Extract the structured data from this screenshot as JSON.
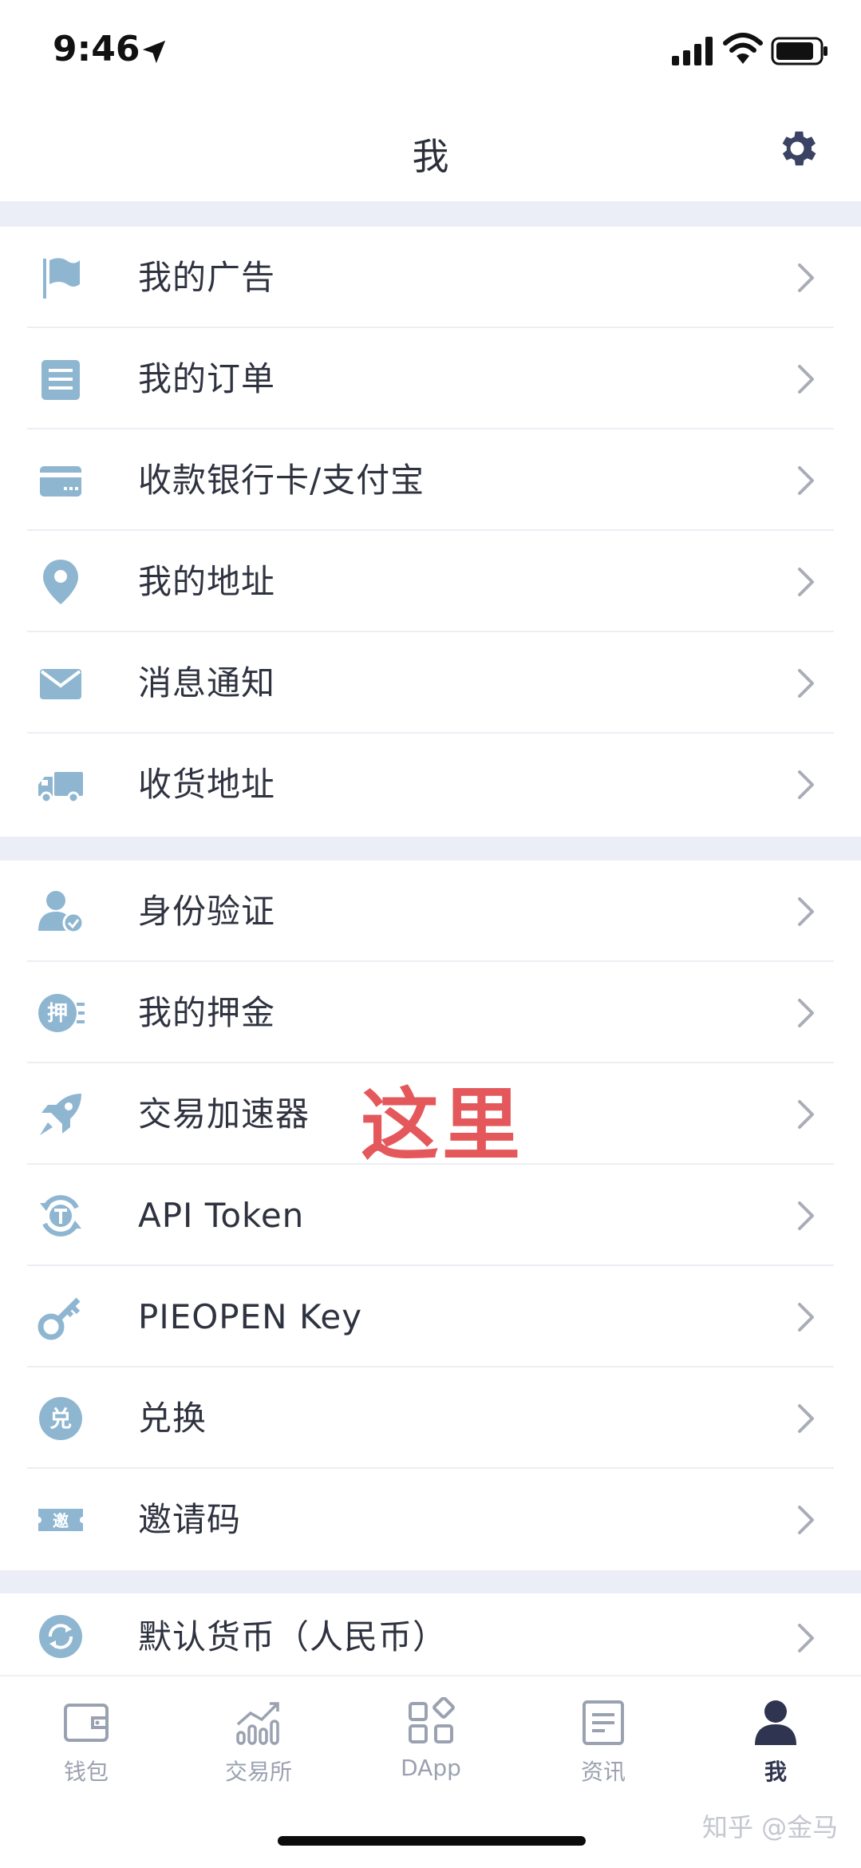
{
  "status": {
    "time": "9:46"
  },
  "header": {
    "title": "我"
  },
  "sections": [
    [
      {
        "label": "我的广告",
        "icon": "flag-icon"
      },
      {
        "label": "我的订单",
        "icon": "document-icon"
      },
      {
        "label": "收款银行卡/支付宝",
        "icon": "card-icon"
      },
      {
        "label": "我的地址",
        "icon": "location-pin-icon"
      },
      {
        "label": "消息通知",
        "icon": "envelope-icon"
      },
      {
        "label": "收货地址",
        "icon": "truck-icon"
      }
    ],
    [
      {
        "label": "身份验证",
        "icon": "user-verified-icon"
      },
      {
        "label": "我的押金",
        "icon": "deposit-icon"
      },
      {
        "label": "交易加速器",
        "icon": "rocket-icon"
      },
      {
        "label": "API Token",
        "icon": "token-icon"
      },
      {
        "label": "PIEOPEN Key",
        "icon": "key-icon"
      },
      {
        "label": "兑换",
        "icon": "exchange-icon"
      },
      {
        "label": "邀请码",
        "icon": "invite-ticket-icon"
      }
    ],
    [
      {
        "label": "默认货币（人民币）",
        "icon": "currency-refresh-icon"
      }
    ]
  ],
  "icon_text": {
    "deposit": "押",
    "exchange": "兑",
    "invite": "邀"
  },
  "annotation": "这里",
  "tabs": [
    {
      "label": "钱包",
      "icon": "wallet-icon"
    },
    {
      "label": "交易所",
      "icon": "chart-icon"
    },
    {
      "label": "DApp",
      "icon": "apps-grid-icon"
    },
    {
      "label": "资讯",
      "icon": "news-icon"
    },
    {
      "label": "我",
      "icon": "profile-icon",
      "active": true
    }
  ],
  "watermark": "知乎 @金马",
  "colors": {
    "icon": "#8fb6d1",
    "band": "#eceef7",
    "chevron": "#a9adb8",
    "annotation": "#e4585c",
    "active_tab": "#2f3450"
  }
}
